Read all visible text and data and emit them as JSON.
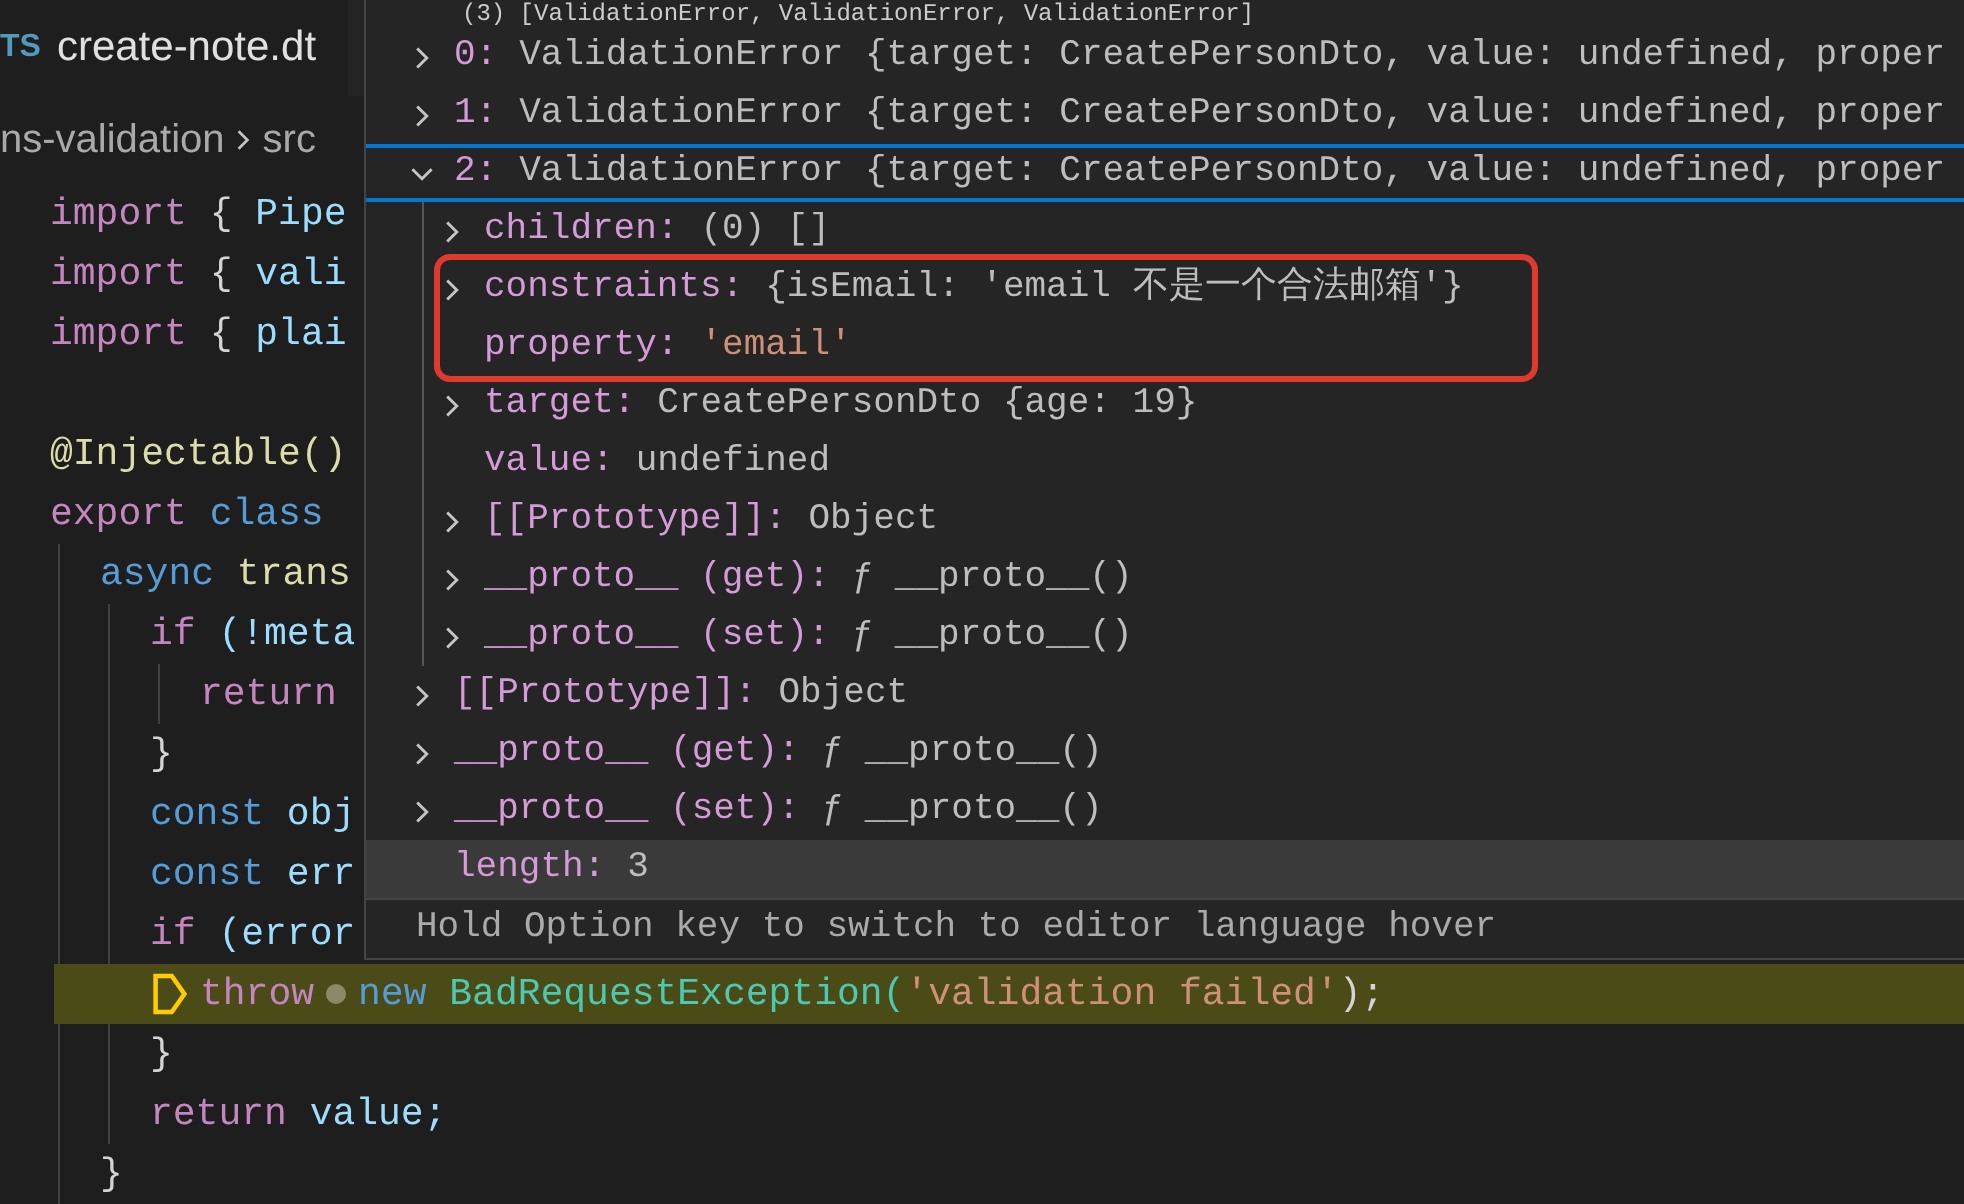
{
  "editor": {
    "tab": {
      "icon_text": "TS",
      "label": "create-note.dt",
      "selected": true
    },
    "breadcrumb": [
      "ns-validation",
      "src"
    ],
    "lines": [
      {
        "tokens": [
          {
            "text": "import",
            "kind": "keyword"
          },
          {
            "text": " {",
            "kind": "punct"
          },
          {
            "text": " Pipe",
            "kind": "ident"
          }
        ]
      },
      {
        "tokens": [
          {
            "text": "import",
            "kind": "keyword"
          },
          {
            "text": " {",
            "kind": "punct"
          },
          {
            "text": " vali",
            "kind": "ident"
          }
        ]
      },
      {
        "tokens": [
          {
            "text": "import",
            "kind": "keyword"
          },
          {
            "text": " {",
            "kind": "punct"
          },
          {
            "text": " plai",
            "kind": "ident"
          }
        ]
      },
      {
        "kind": "blank"
      },
      {
        "tokens": [
          {
            "text": "@Injectable()",
            "kind": "func"
          }
        ]
      },
      {
        "tokens": [
          {
            "text": "export",
            "kind": "keyword"
          },
          {
            "text": " class",
            "kind": "storage"
          }
        ],
        "children": [
          {
            "tokens": [
              {
                "text": "async",
                "kind": "storage"
              },
              {
                "text": " trans",
                "kind": "func"
              }
            ],
            "children": [
              {
                "tokens": [
                  {
                    "text": "if",
                    "kind": "keyword"
                  },
                  {
                    "text": " (!meta",
                    "kind": "ident"
                  }
                ],
                "children": [
                  {
                    "tokens": [
                      {
                        "text": "return",
                        "kind": "keyword"
                      }
                    ]
                  }
                ]
              },
              {
                "tokens": [
                  {
                    "text": "}",
                    "kind": "punct"
                  }
                ]
              },
              {
                "tokens": [
                  {
                    "text": "const",
                    "kind": "storage"
                  },
                  {
                    "text": " obj",
                    "kind": "ident"
                  }
                ]
              },
              {
                "tokens": [
                  {
                    "text": "const",
                    "kind": "storage"
                  },
                  {
                    "text": " err",
                    "kind": "ident"
                  }
                ]
              },
              {
                "tokens": [
                  {
                    "text": "if",
                    "kind": "keyword"
                  },
                  {
                    "text": " (error",
                    "kind": "ident"
                  }
                ],
                "children": [
                  {
                    "current": true,
                    "tokens": [
                      {
                        "text": "throw",
                        "kind": "keyword"
                      },
                      {
                        "text": "new",
                        "kind": "storage"
                      },
                      {
                        "text": " BadRequestException(",
                        "kind": "type"
                      },
                      {
                        "text": "'validation failed'",
                        "kind": "string"
                      },
                      {
                        "text": ");",
                        "kind": "punct"
                      }
                    ]
                  }
                ]
              },
              {
                "tokens": [
                  {
                    "text": "}",
                    "kind": "punct"
                  }
                ]
              },
              {
                "tokens": [
                  {
                    "text": "return",
                    "kind": "keyword"
                  },
                  {
                    "text": " value;",
                    "kind": "ident"
                  }
                ]
              }
            ]
          },
          {
            "tokens": [
              {
                "text": "}",
                "kind": "punct"
              }
            ]
          }
        ]
      }
    ]
  },
  "hover": {
    "header": "(3) [ValidationError, ValidationError, ValidationError]",
    "rows": [
      {
        "name": "0:",
        "value": "ValidationError {target: CreatePersonDto, value: undefined, proper",
        "expandable": true,
        "expanded": false,
        "selected": false
      },
      {
        "name": "1:",
        "value": "ValidationError {target: CreatePersonDto, value: undefined, proper",
        "expandable": true,
        "expanded": false,
        "selected": false
      },
      {
        "name": "2:",
        "value": "ValidationError {target: CreatePersonDto, value: undefined, proper",
        "expandable": true,
        "expanded": true,
        "selected": true,
        "children": [
          {
            "name": "children:",
            "value": "(0) []",
            "expandable": true,
            "expanded": false,
            "selected": false
          },
          {
            "name": "constraints:",
            "value": "{isEmail: 'email 不是一个合法邮箱'}",
            "expandable": true,
            "expanded": false,
            "selected": false,
            "outlined": true
          },
          {
            "name": "property:",
            "value": "'email'",
            "kind": "string",
            "expandable": false,
            "selected": false,
            "outlined": true
          },
          {
            "name": "target:",
            "value": "CreatePersonDto {age: 19}",
            "expandable": true,
            "expanded": false,
            "selected": false
          },
          {
            "name": "value:",
            "value": "undefined",
            "expandable": false,
            "selected": false
          },
          {
            "name": "[[Prototype]]:",
            "value": "Object",
            "expandable": true,
            "expanded": false,
            "selected": false
          },
          {
            "name": "__proto__ (get):",
            "value": "ƒ __proto__()",
            "expandable": true,
            "expanded": false,
            "selected": false
          },
          {
            "name": "__proto__ (set):",
            "value": "ƒ __proto__()",
            "expandable": true,
            "expanded": false,
            "selected": false
          }
        ]
      },
      {
        "name": "[[Prototype]]:",
        "value": "Object",
        "expandable": true,
        "expanded": false,
        "selected": false
      },
      {
        "name": "__proto__ (get):",
        "value": "ƒ __proto__()",
        "expandable": true,
        "expanded": false,
        "selected": false
      },
      {
        "name": "__proto__ (set):",
        "value": "ƒ __proto__()",
        "expandable": true,
        "expanded": false,
        "selected": false
      },
      {
        "name": "length:",
        "value": "3",
        "expandable": false,
        "selected": false,
        "hovered": true
      }
    ],
    "footer": "Hold Option key to switch to editor language hover"
  }
}
